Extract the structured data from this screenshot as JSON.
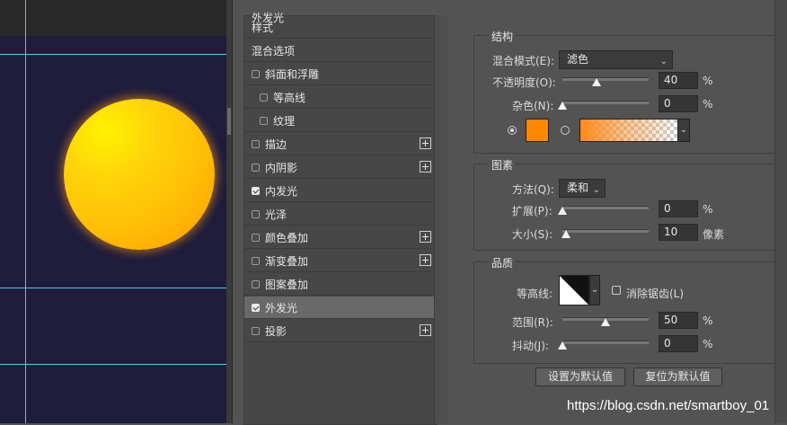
{
  "styles_panel": {
    "items": [
      {
        "label": "样式",
        "checkbox": false,
        "plus": false,
        "indent": 0
      },
      {
        "label": "混合选项",
        "checkbox": false,
        "plus": false,
        "indent": 0
      },
      {
        "label": "斜面和浮雕",
        "checkbox": true,
        "checked": false,
        "plus": false,
        "indent": 0
      },
      {
        "label": "等高线",
        "checkbox": true,
        "checked": false,
        "plus": false,
        "indent": 1
      },
      {
        "label": "纹理",
        "checkbox": true,
        "checked": false,
        "plus": false,
        "indent": 1
      },
      {
        "label": "描边",
        "checkbox": true,
        "checked": false,
        "plus": true,
        "indent": 0
      },
      {
        "label": "内阴影",
        "checkbox": true,
        "checked": false,
        "plus": true,
        "indent": 0
      },
      {
        "label": "内发光",
        "checkbox": true,
        "checked": true,
        "plus": false,
        "indent": 0
      },
      {
        "label": "光泽",
        "checkbox": true,
        "checked": false,
        "plus": false,
        "indent": 0
      },
      {
        "label": "颜色叠加",
        "checkbox": true,
        "checked": false,
        "plus": true,
        "indent": 0
      },
      {
        "label": "渐变叠加",
        "checkbox": true,
        "checked": false,
        "plus": true,
        "indent": 0
      },
      {
        "label": "图案叠加",
        "checkbox": true,
        "checked": false,
        "plus": false,
        "indent": 0
      },
      {
        "label": "外发光",
        "checkbox": true,
        "checked": true,
        "plus": false,
        "indent": 0,
        "selected": true
      },
      {
        "label": "投影",
        "checkbox": true,
        "checked": false,
        "plus": true,
        "indent": 0
      }
    ]
  },
  "outer_glow": {
    "title": "外发光",
    "structure": {
      "title": "结构",
      "blend_mode_label": "混合模式(E):",
      "blend_mode_value": "滤色",
      "opacity_label": "不透明度(O):",
      "opacity_value": "40",
      "opacity_unit": "%",
      "opacity_level": 0.4,
      "noise_label": "杂色(N):",
      "noise_value": "0",
      "noise_unit": "%",
      "noise_level": 0,
      "glow_color": "#ff8800",
      "solid_color_selected": true
    },
    "elements": {
      "title": "图素",
      "technique_label": "方法(Q):",
      "technique_value": "柔和",
      "spread_label": "扩展(P):",
      "spread_value": "0",
      "spread_unit": "%",
      "spread_level": 0,
      "size_label": "大小(S):",
      "size_value": "10",
      "size_unit": "像素",
      "size_level": 0.04
    },
    "quality": {
      "title": "品质",
      "contour_label": "等高线:",
      "antialias_label": "消除锯齿(L)",
      "antialias_checked": false,
      "range_label": "范围(R):",
      "range_value": "50",
      "range_unit": "%",
      "range_level": 0.5,
      "jitter_label": "抖动(J):",
      "jitter_value": "0",
      "jitter_unit": "%",
      "jitter_level": 0
    },
    "buttons": {
      "make_default": "设置为默认值",
      "reset_default": "复位为默认值"
    }
  },
  "watermark": "https://blog.csdn.net/smartboy_01",
  "colors": {
    "canvas_bg": "#1f1d3c",
    "guide": "#3fd3e6",
    "sun_core": "#ffc107",
    "selected_row": "#696969"
  }
}
